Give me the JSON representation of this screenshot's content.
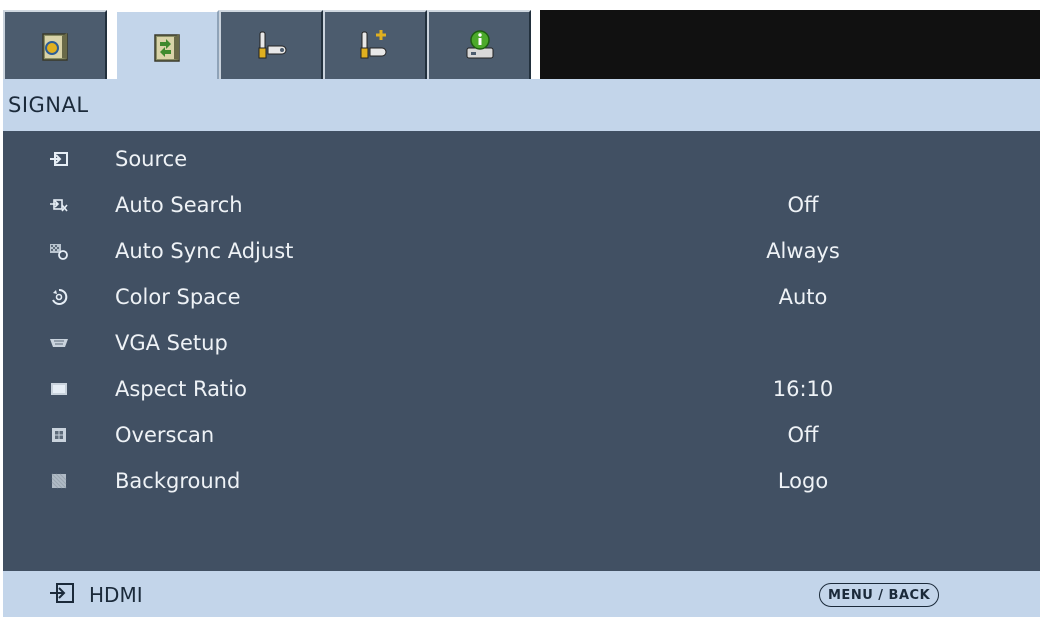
{
  "tabs": [
    {
      "id": "image",
      "icon": "image-settings-icon"
    },
    {
      "id": "signal",
      "icon": "signal-settings-icon",
      "active": true
    },
    {
      "id": "setting1",
      "icon": "setting-tools-icon"
    },
    {
      "id": "setting2",
      "icon": "advanced-setting-icon"
    },
    {
      "id": "info",
      "icon": "information-icon"
    }
  ],
  "header": {
    "title": "SIGNAL"
  },
  "menu": [
    {
      "icon": "source-icon",
      "label": "Source",
      "value": ""
    },
    {
      "icon": "auto-search-icon",
      "label": "Auto Search",
      "value": "Off"
    },
    {
      "icon": "auto-sync-icon",
      "label": "Auto Sync Adjust",
      "value": "Always"
    },
    {
      "icon": "color-space-icon",
      "label": "Color Space",
      "value": "Auto"
    },
    {
      "icon": "vga-setup-icon",
      "label": "VGA Setup",
      "value": ""
    },
    {
      "icon": "aspect-ratio-icon",
      "label": "Aspect Ratio",
      "value": "16:10"
    },
    {
      "icon": "overscan-icon",
      "label": "Overscan",
      "value": "Off"
    },
    {
      "icon": "background-icon",
      "label": "Background",
      "value": "Logo"
    }
  ],
  "footer": {
    "source": "HDMI",
    "button": "MENU / BACK"
  },
  "colors": {
    "panel": "#415063",
    "header": "#c3d5ea",
    "tab": "#4c5c6e",
    "topbar": "#111111"
  }
}
